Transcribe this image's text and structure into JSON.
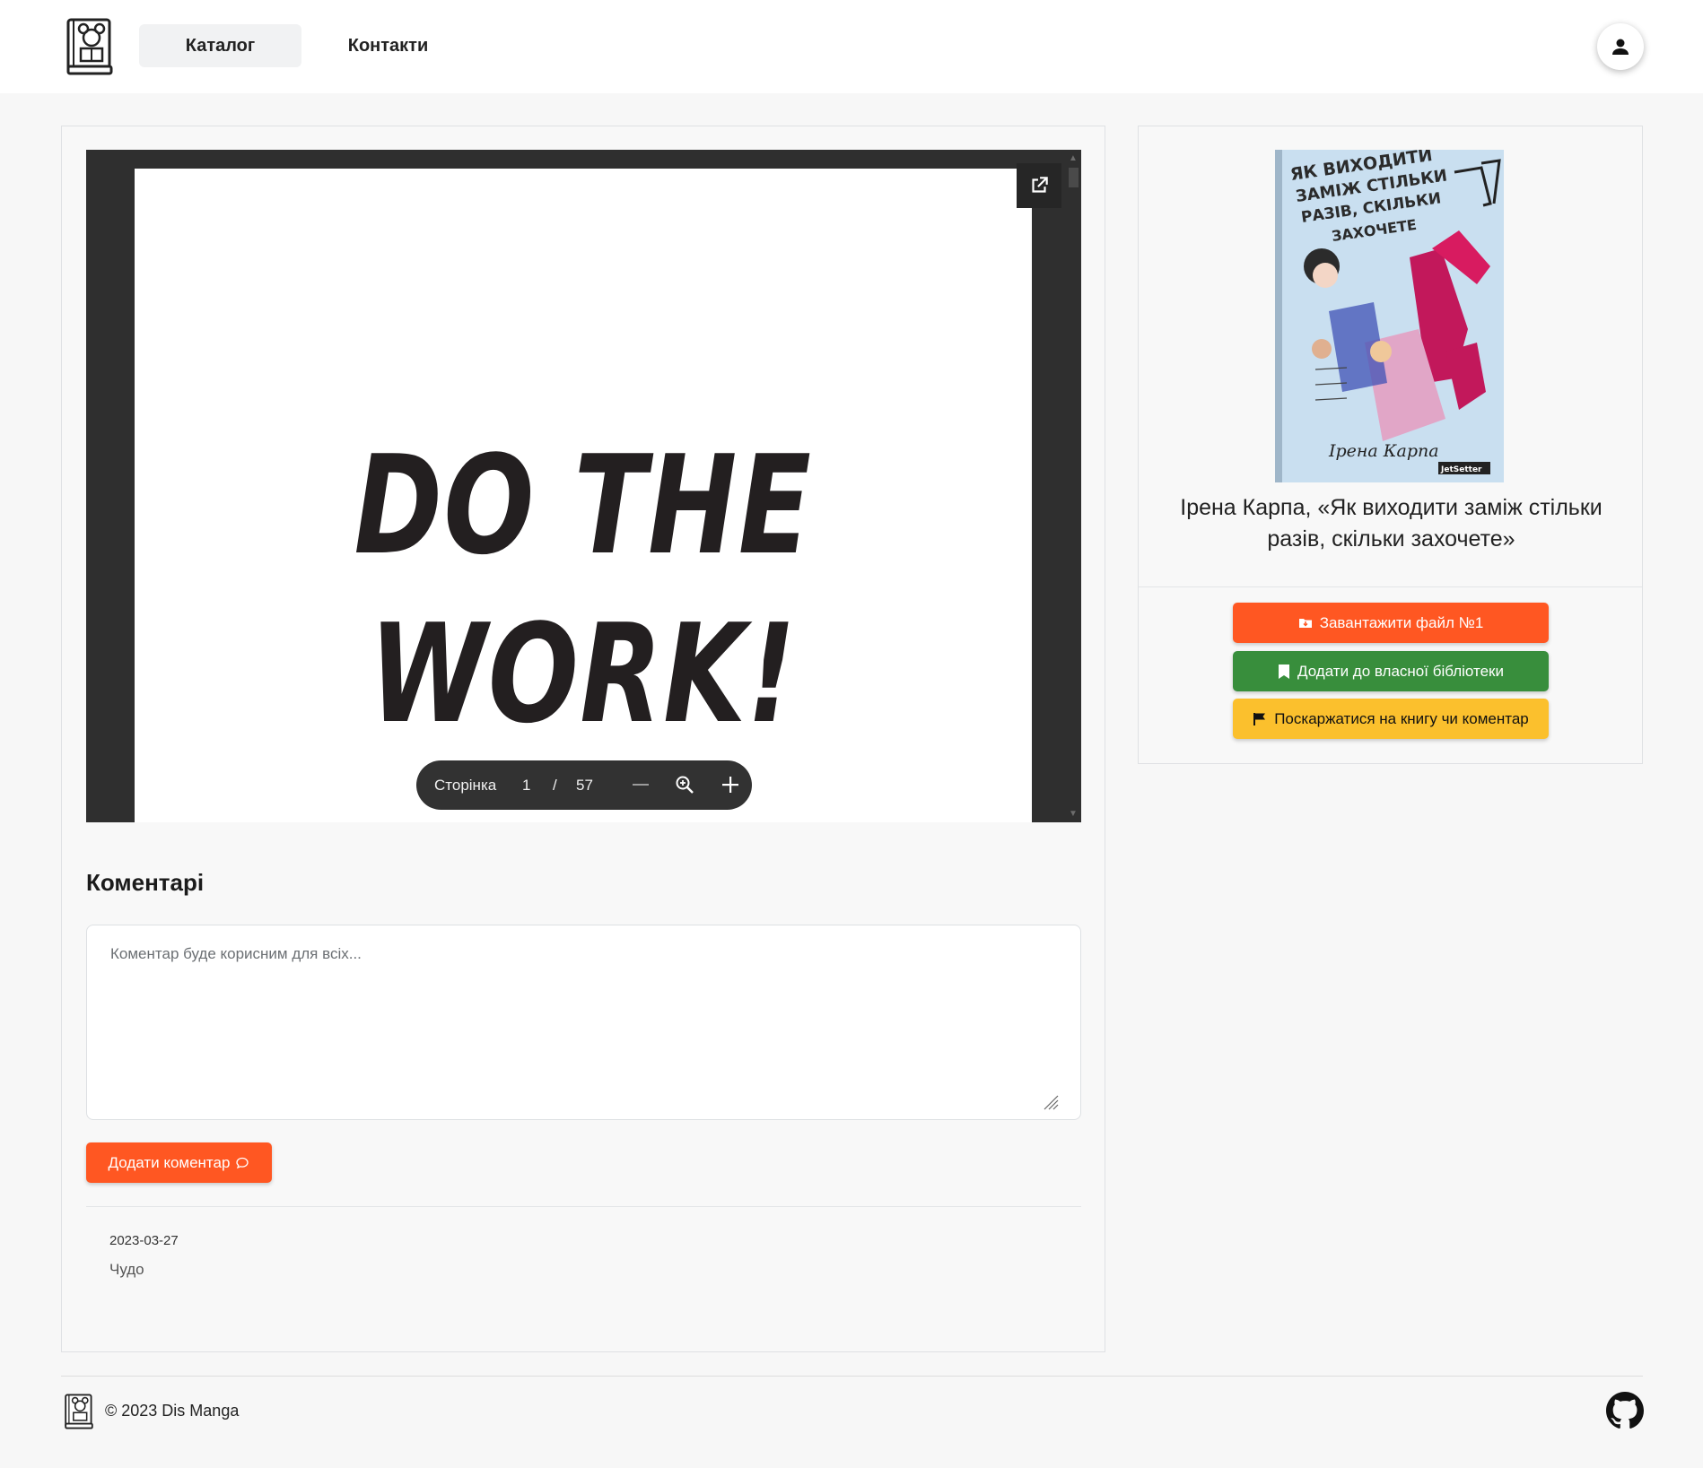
{
  "header": {
    "logo_icon": "book-reader-logo-icon",
    "nav": [
      {
        "label": "Каталог"
      },
      {
        "label": "Контакти"
      }
    ],
    "profile_icon": "user-icon"
  },
  "pdf_viewer": {
    "page_text_line1": "DO THE",
    "page_text_line2": "WORK!",
    "toolbar": {
      "page_label": "Сторінка",
      "current_page": "1",
      "separator": "/",
      "total_pages": "57"
    }
  },
  "comments": {
    "title": "Коментарі",
    "placeholder": "Коментар буде корисним для всіх...",
    "add_button": "Додати коментар",
    "items": [
      {
        "date": "2023-03-27",
        "text": "Чудо"
      }
    ]
  },
  "book": {
    "cover_title": "ЯК ВИХОДИТИ ЗАМІЖ СТІЛЬКИ РАЗІВ, СКІЛЬКИ ЗАХОЧЕТЕ",
    "cover_author": "Ірена Карпа",
    "cover_publisher": "JetSetter",
    "title": "Ірена Карпа, «Як виходити заміж стільки разів, скільки захочете»",
    "buttons": {
      "download": "Завантажити файл №1",
      "library": "Додати до власної бібліотеки",
      "report": "Поскаржатися на книгу чи коментар"
    },
    "colors": {
      "download": "#ff5722",
      "library": "#388e3c",
      "report": "#fbc02d"
    }
  },
  "footer": {
    "copyright": "© 2023 Dis Manga",
    "github_icon": "github-icon"
  }
}
